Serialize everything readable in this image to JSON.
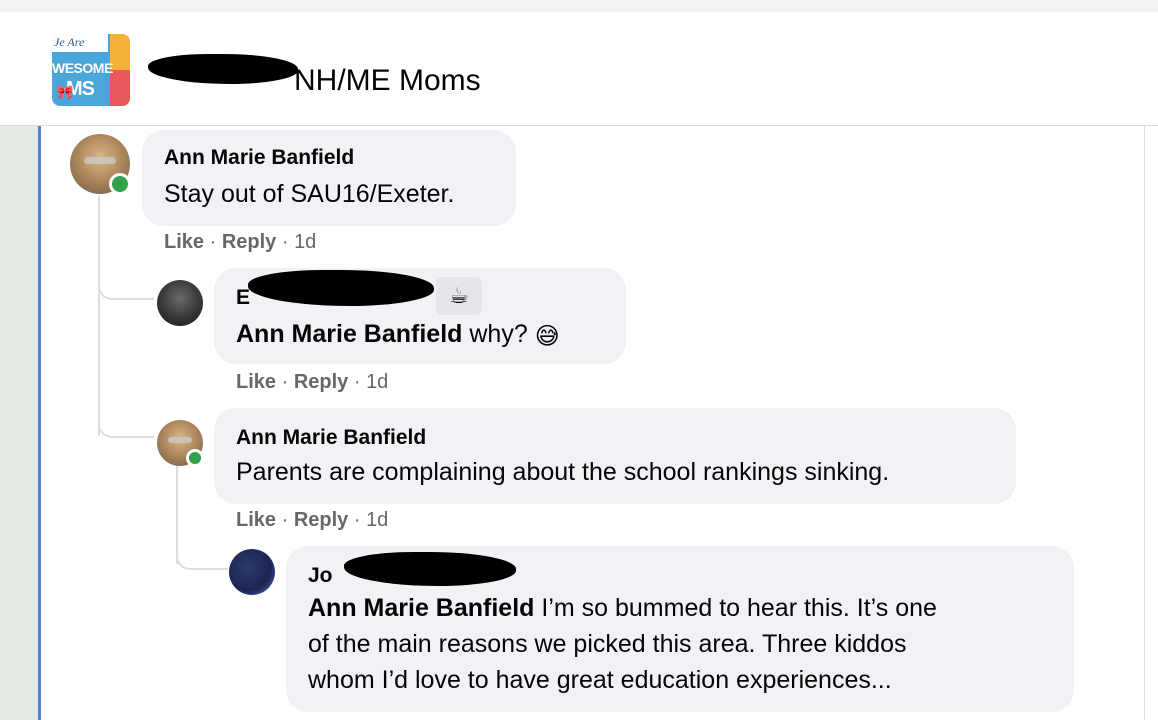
{
  "header": {
    "group_name": "NH/ME Moms",
    "logo": {
      "line1": "Je Are",
      "line2": "WESOME",
      "line3": "MS"
    }
  },
  "comments": [
    {
      "author": "Ann Marie Banfield",
      "text": "Stay out of SAU16/Exeter.",
      "actions": {
        "like": "Like",
        "reply": "Reply",
        "time": "1d"
      }
    },
    {
      "author_visible": "E",
      "mention": "Ann Marie Banfield",
      "text": " why? ",
      "emoji": "😅",
      "badge_icon": "coffee-cup-icon",
      "badge_glyph": "☕",
      "actions": {
        "like": "Like",
        "reply": "Reply",
        "time": "1d"
      }
    },
    {
      "author": "Ann Marie Banfield",
      "text": "Parents are complaining about the school rankings sinking.",
      "actions": {
        "like": "Like",
        "reply": "Reply",
        "time": "1d"
      }
    },
    {
      "author_visible": "Jo",
      "mention": "Ann Marie Banfield",
      "text_line1": " I’m so bummed to hear this. It’s one",
      "text_line2": "of the main reasons we picked this area. Three kiddos",
      "text_line3": "whom I’d love to have great education experiences..."
    }
  ],
  "colors": {
    "bubble": "#f0f2f5",
    "meta": "#65676b",
    "online": "#31a24c",
    "rail": "#5b7fd6"
  }
}
